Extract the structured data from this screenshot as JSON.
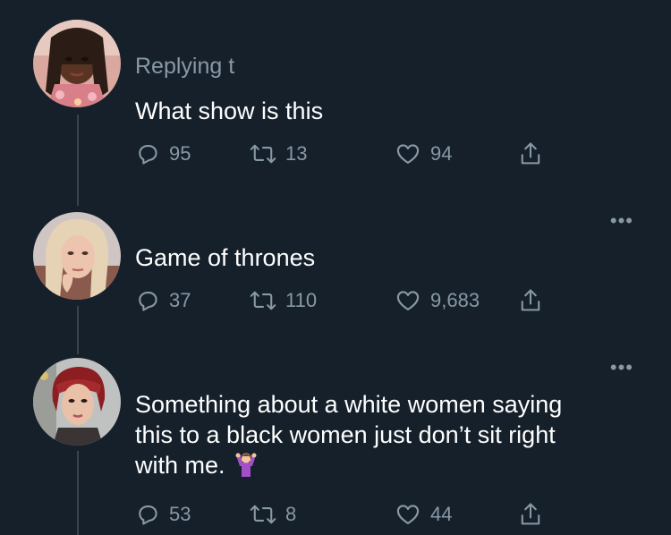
{
  "theme": {
    "background": "#15202b",
    "muted": "#8899a6",
    "thread_line": "#38444d"
  },
  "tweets": [
    {
      "replying_to": "Replying t",
      "text": "What show is this",
      "replies": "95",
      "retweets": "13",
      "likes": "94"
    },
    {
      "text": "Game of thrones",
      "replies": "37",
      "retweets": "110",
      "likes": "9,683",
      "more": "•••"
    },
    {
      "text_lines": [
        "Something about a white women saying",
        "this to a black women just don’t sit right",
        "with me."
      ],
      "emoji": "woman-shrugging-emoji",
      "replies": "53",
      "retweets": "8",
      "likes": "44",
      "more": "•••"
    }
  ],
  "icons": {
    "reply": "reply-icon",
    "retweet": "retweet-icon",
    "like": "heart-icon",
    "share": "share-icon"
  }
}
